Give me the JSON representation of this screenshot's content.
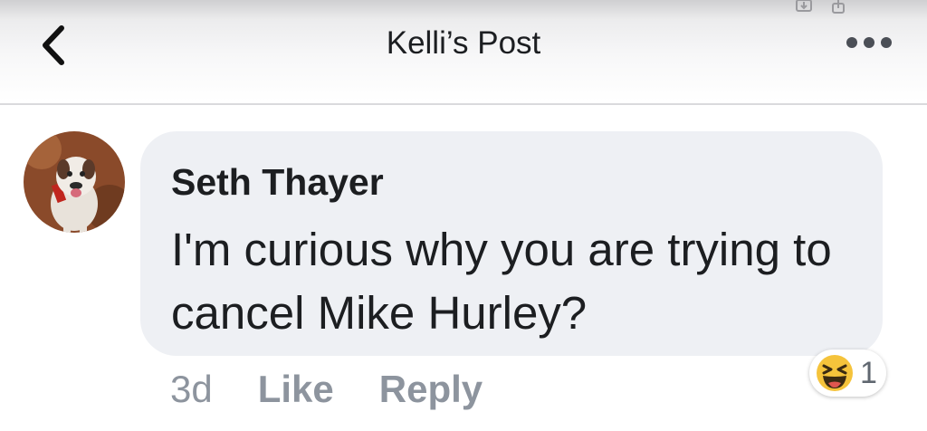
{
  "header": {
    "title": "Kelli’s Post",
    "back_icon": "chevron-left-icon",
    "more_icon": "more-horizontal-icon"
  },
  "comment": {
    "author": "Seth Thayer",
    "text": "I'm curious why you are trying to cancel Mike Hurley?",
    "time": "3d",
    "like_label": "Like",
    "reply_label": "Reply",
    "reaction": {
      "icon": "laughing-emoji-icon",
      "count": "1"
    }
  },
  "colors": {
    "bubble": "#eef0f4",
    "meta_text": "#8d949e",
    "primary_text": "#1c1e21"
  }
}
